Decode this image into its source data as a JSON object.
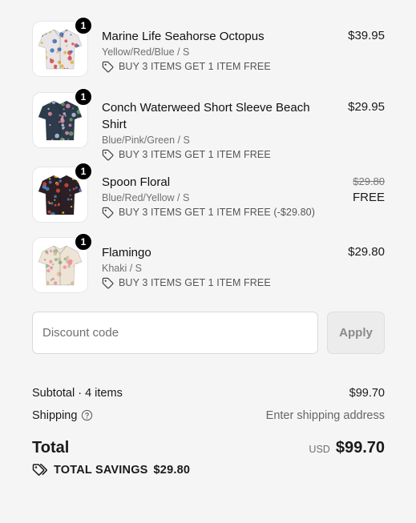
{
  "items": [
    {
      "name": "Marine Life Seahorse Octopus",
      "variant": "Yellow/Red/Blue / S",
      "promo": "BUY 3 ITEMS GET 1 ITEM FREE",
      "price": "$39.95",
      "quantity": "1",
      "shirt_colors": {
        "base": "#e9e4e6",
        "dots": [
          "#d0464a",
          "#3b72b3",
          "#e0b33c"
        ]
      }
    },
    {
      "name": "Conch Waterweed Short Sleeve Beach Shirt",
      "variant": "Blue/Pink/Green / S",
      "promo": "BUY 3 ITEMS GET 1 ITEM FREE",
      "price": "$29.95",
      "quantity": "1",
      "shirt_colors": {
        "base": "#2d3b4c",
        "dots": [
          "#e48fa6",
          "#6fa36a",
          "#b6c7d8"
        ]
      }
    },
    {
      "name": "Spoon Floral",
      "variant": "Blue/Red/Yellow / S",
      "promo": "BUY 3 ITEMS GET 1 ITEM FREE (-$29.80)",
      "original_price": "$29.80",
      "price": "FREE",
      "quantity": "1",
      "shirt_colors": {
        "base": "#2a1f24",
        "dots": [
          "#d64a3a",
          "#e8c63b",
          "#4a7fc4"
        ]
      }
    },
    {
      "name": "Flamingo",
      "variant": "Khaki / S",
      "promo": "BUY 3 ITEMS GET 1 ITEM FREE",
      "price": "$29.80",
      "quantity": "1",
      "shirt_colors": {
        "base": "#ede4d6",
        "dots": [
          "#e68fa0",
          "#8fb68a",
          "#d8b79a"
        ]
      }
    }
  ],
  "discount": {
    "placeholder": "Discount code",
    "apply_label": "Apply"
  },
  "summary": {
    "subtotal_label": "Subtotal · 4 items",
    "subtotal_value": "$99.70",
    "shipping_label": "Shipping",
    "shipping_value": "Enter shipping address",
    "total_label": "Total",
    "currency": "USD",
    "total_value": "$99.70",
    "savings_label": "TOTAL SAVINGS",
    "savings_value": "$29.80"
  }
}
